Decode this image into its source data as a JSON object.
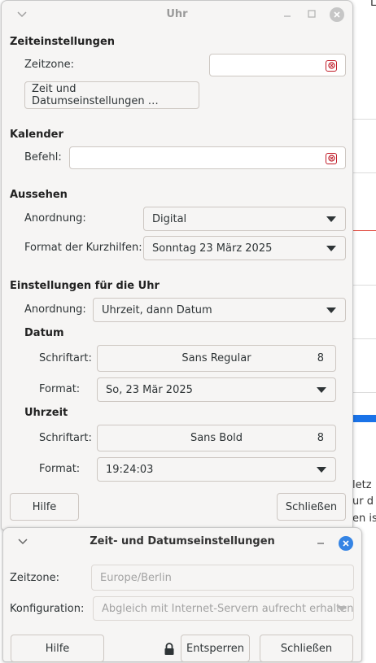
{
  "background": {
    "top_letter": "L",
    "lines": [
      "letz",
      "ur d",
      "en is"
    ],
    "accent_color": "#1a73e8",
    "divider_color": "#e0483c"
  },
  "clock_window": {
    "title": "Uhr",
    "time_settings": {
      "heading": "Zeiteinstellungen",
      "timezone_label": "Zeitzone:",
      "timezone_value": "",
      "datetime_button": "Zeit und Datumseinstellungen …"
    },
    "calendar": {
      "heading": "Kalender",
      "command_label": "Befehl:",
      "command_value": ""
    },
    "appearance": {
      "heading": "Aussehen",
      "layout_label": "Anordnung:",
      "layout_value": "Digital",
      "tooltip_format_label": "Format der Kurzhilfen:",
      "tooltip_format_value": "Sonntag 23 März 2025"
    },
    "clock_settings": {
      "heading": "Einstellungen für die Uhr",
      "layout_label": "Anordnung:",
      "layout_value": "Uhrzeit, dann Datum",
      "date": {
        "heading": "Datum",
        "font_label": "Schriftart:",
        "font_name": "Sans Regular",
        "font_size": "8",
        "format_label": "Format:",
        "format_value": "So, 23 Mär 2025"
      },
      "time": {
        "heading": "Uhrzeit",
        "font_label": "Schriftart:",
        "font_name": "Sans Bold",
        "font_size": "8",
        "format_label": "Format:",
        "format_value": "19:24:03"
      }
    },
    "help_button": "Hilfe",
    "close_button": "Schließen"
  },
  "datetime_window": {
    "title": "Zeit- und Datumseinstellungen",
    "timezone_label": "Zeitzone:",
    "timezone_value": "Europe/Berlin",
    "config_label": "Konfiguration:",
    "config_value": "Abgleich mit Internet-Servern aufrecht erhalten",
    "help_button": "Hilfe",
    "unlock_button": "Entsperren",
    "close_button": "Schließen",
    "close_color": "#3584e4"
  }
}
